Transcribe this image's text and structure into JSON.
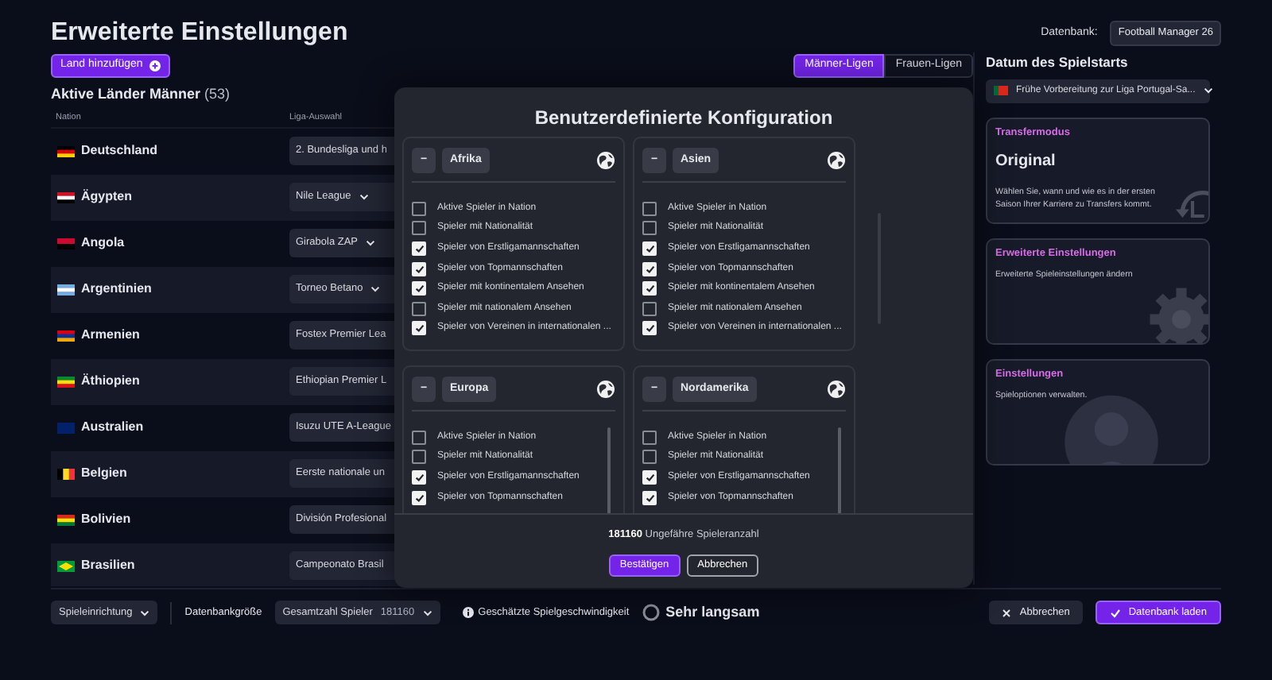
{
  "header": {
    "title": "Erweiterte Einstellungen",
    "add_button": "Land hinzufügen",
    "database_label": "Datenbank:",
    "database_value": "Football Manager 26"
  },
  "league_tabs": [
    {
      "label": "Männer-Ligen",
      "selected": true
    },
    {
      "label": "Frauen-Ligen",
      "selected": false
    }
  ],
  "countries": {
    "title": "Aktive Länder Männer",
    "count": "(53)",
    "columns": [
      "Nation",
      "Liga-Auswahl"
    ],
    "rows": [
      {
        "name": "Deutschland",
        "league": "2. Bundesliga und h",
        "chevron": false
      },
      {
        "name": "Ägypten",
        "league": "Nile League",
        "chevron": true
      },
      {
        "name": "Angola",
        "league": "Girabola ZAP",
        "chevron": true
      },
      {
        "name": "Argentinien",
        "league": "Torneo Betano",
        "chevron": true
      },
      {
        "name": "Armenien",
        "league": "Fostex Premier Lea",
        "chevron": false
      },
      {
        "name": "Äthiopien",
        "league": "Ethiopian Premier L",
        "chevron": false
      },
      {
        "name": "Australien",
        "league": "Isuzu UTE A-League",
        "chevron": false
      },
      {
        "name": "Belgien",
        "league": "Eerste nationale un",
        "chevron": false
      },
      {
        "name": "Bolivien",
        "league": "División Profesional",
        "chevron": false
      },
      {
        "name": "Brasilien",
        "league": "Campeonato Brasil",
        "chevron": false
      }
    ]
  },
  "config_modal": {
    "title": "Benutzerdefinierte Konfiguration",
    "regions": [
      {
        "collapse": "−",
        "name": "Afrika",
        "options": [
          {
            "label": "Aktive Spieler in Nation",
            "checked": false
          },
          {
            "label": "Spieler mit Nationalität",
            "checked": false
          },
          {
            "label": "Spieler von Erstligamannschaften",
            "checked": true
          },
          {
            "label": "Spieler von Topmannschaften",
            "checked": true
          },
          {
            "label": "Spieler mit kontinentalem Ansehen",
            "checked": true
          },
          {
            "label": "Spieler mit nationalem Ansehen",
            "checked": false
          },
          {
            "label": "Spieler von Vereinen in internationalen ...",
            "checked": true
          }
        ]
      },
      {
        "collapse": "−",
        "name": "Asien",
        "options": [
          {
            "label": "Aktive Spieler in Nation",
            "checked": false
          },
          {
            "label": "Spieler mit Nationalität",
            "checked": false
          },
          {
            "label": "Spieler von Erstligamannschaften",
            "checked": true
          },
          {
            "label": "Spieler von Topmannschaften",
            "checked": true
          },
          {
            "label": "Spieler mit kontinentalem Ansehen",
            "checked": true
          },
          {
            "label": "Spieler mit nationalem Ansehen",
            "checked": false
          },
          {
            "label": "Spieler von Vereinen in internationalen ...",
            "checked": true
          }
        ]
      },
      {
        "collapse": "−",
        "name": "Europa",
        "options": [
          {
            "label": "Aktive Spieler in Nation",
            "checked": false
          },
          {
            "label": "Spieler mit Nationalität",
            "checked": false
          },
          {
            "label": "Spieler von Erstligamannschaften",
            "checked": true
          },
          {
            "label": "Spieler von Topmannschaften",
            "checked": true
          }
        ]
      },
      {
        "collapse": "−",
        "name": "Nordamerika",
        "options": [
          {
            "label": "Aktive Spieler in Nation",
            "checked": false
          },
          {
            "label": "Spieler mit Nationalität",
            "checked": false
          },
          {
            "label": "Spieler von Erstligamannschaften",
            "checked": true
          },
          {
            "label": "Spieler von Topmannschaften",
            "checked": true
          }
        ]
      }
    ],
    "player_count": "181160",
    "player_count_label": "Ungefähre Spieleranzahl",
    "confirm": "Bestätigen",
    "cancel": "Abbrechen"
  },
  "start_date": {
    "label": "Datum des Spielstarts",
    "value": "Frühe Vorbereitung zur Liga Portugal-Sa..."
  },
  "panels": [
    {
      "kind": "clock",
      "title": "Transfermodus",
      "value": "Original",
      "description": "Wählen Sie, wann und wie es in der ersten Saison Ihrer Karriere zu Transfers kommt."
    },
    {
      "kind": "gear",
      "title": "Erweiterte Einstellungen",
      "description": "Erweiterte Spieleinstellungen ändern"
    },
    {
      "kind": "person",
      "title": "Einstellungen",
      "description": "Spieloptionen verwalten."
    }
  ],
  "footer": {
    "setup_select": "Spieleinrichtung",
    "size_label": "Datenbankgröße",
    "size_select": "Gesamtzahl Spieler",
    "size_value": "181160",
    "speed_label": "Geschätzte Spielgeschwindigkeit",
    "speed_value": "Sehr langsam",
    "cancel": "Abbrechen",
    "load": "Datenbank laden"
  }
}
